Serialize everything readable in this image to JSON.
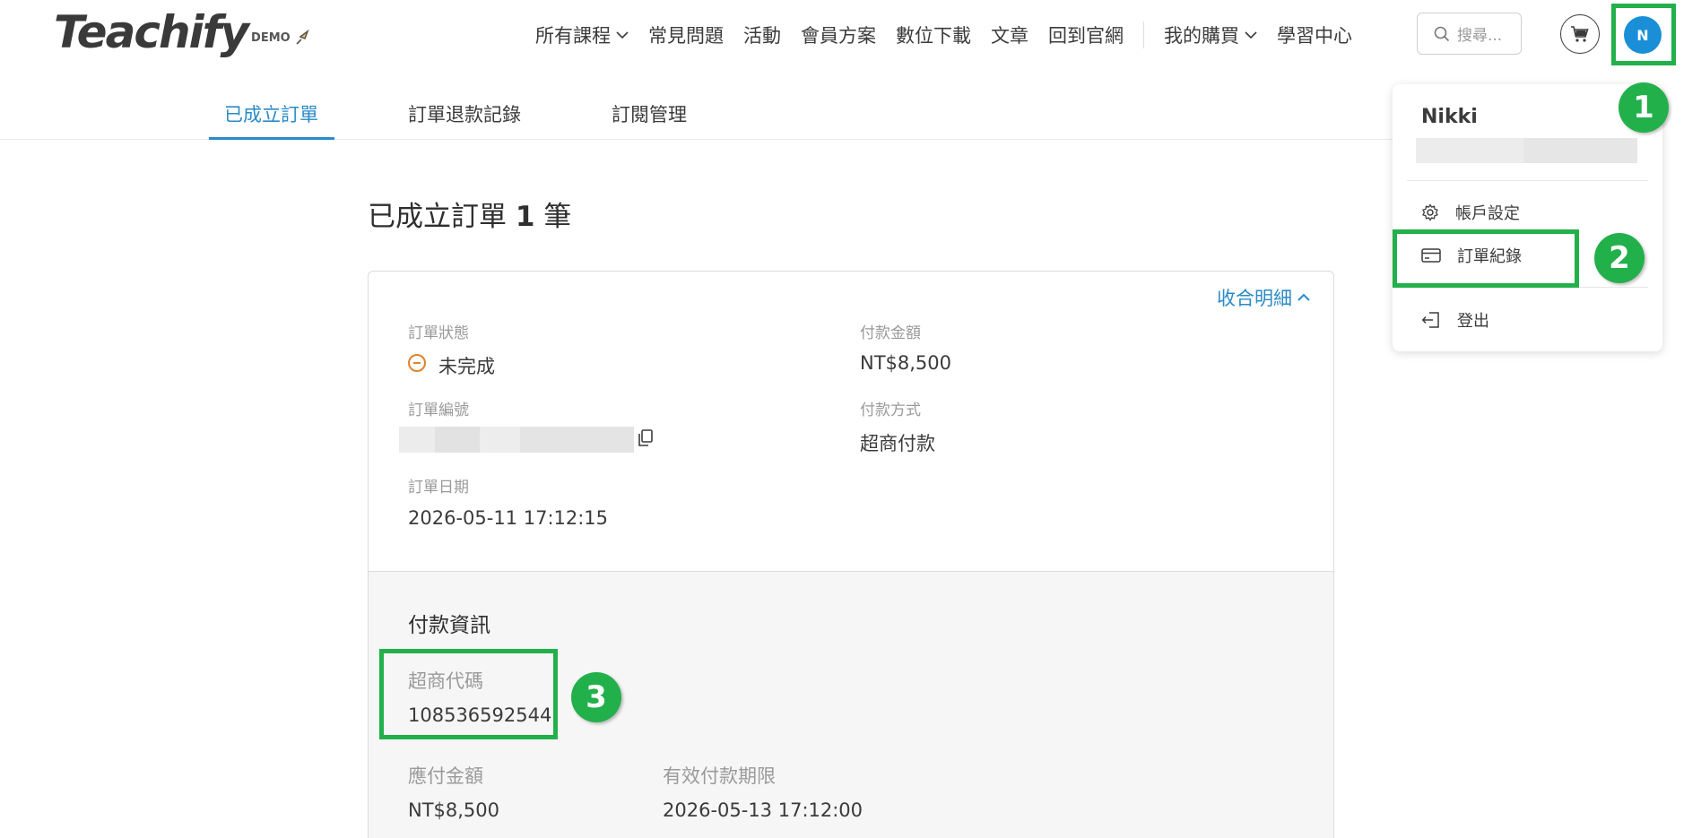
{
  "header": {
    "logo_text": "Teachify",
    "logo_badge": "DEMO",
    "nav": [
      {
        "label": "所有課程",
        "dropdown": true
      },
      {
        "label": "常見問題",
        "dropdown": false
      },
      {
        "label": "活動",
        "dropdown": false
      },
      {
        "label": "會員方案",
        "dropdown": false
      },
      {
        "label": "數位下載",
        "dropdown": false
      },
      {
        "label": "文章",
        "dropdown": false
      },
      {
        "label": "回到官網",
        "dropdown": false
      }
    ],
    "nav_right": [
      {
        "label": "我的購買",
        "dropdown": true
      },
      {
        "label": "學習中心",
        "dropdown": false
      }
    ],
    "search_placeholder": "搜尋...",
    "avatar_initial": "N"
  },
  "tabs": [
    {
      "label": "已成立訂單",
      "active": true
    },
    {
      "label": "訂單退款記錄",
      "active": false
    },
    {
      "label": "訂閱管理",
      "active": false
    }
  ],
  "page": {
    "title_prefix": "已成立訂單",
    "count": "1",
    "title_suffix": "筆"
  },
  "order": {
    "collapse_label": "收合明細",
    "status_label": "訂單狀態",
    "status_value": "未完成",
    "amount_label": "付款金額",
    "amount_value": "NT$8,500",
    "number_label": "訂單編號",
    "method_label": "付款方式",
    "method_value": "超商付款",
    "date_label": "訂單日期",
    "date_value": "2026-05-11 17:12:15"
  },
  "payment": {
    "title": "付款資訊",
    "code_label": "超商代碼",
    "code_value": "108536592544",
    "due_label": "應付金額",
    "due_value": "NT$8,500",
    "deadline_label": "有效付款期限",
    "deadline_value": "2026-05-13 17:12:00"
  },
  "user_menu": {
    "name": "Nikki",
    "items": [
      {
        "label": "帳戶設定",
        "icon": "gear-icon"
      },
      {
        "label": "訂單紀錄",
        "icon": "card-icon"
      },
      {
        "label": "登出",
        "icon": "logout-icon"
      }
    ]
  },
  "annotations": {
    "step1": "1",
    "step2": "2",
    "step3": "3",
    "highlight_color": "#22b04b"
  },
  "colors": {
    "accent": "#2a8bc7",
    "avatar": "#1a8fd8",
    "pending": "#e0822e"
  }
}
